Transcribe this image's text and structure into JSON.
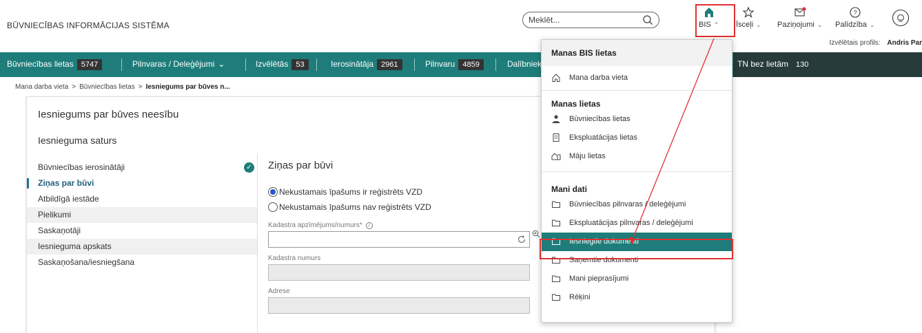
{
  "header": {
    "brand": "BŪVNIECĪBAS INFORMĀCIJAS SISTĒMA",
    "search_placeholder": "Meklēt...",
    "items": [
      {
        "label": "BIS",
        "icon": "home-icon"
      },
      {
        "label": "Īsceļi",
        "icon": "star-icon"
      },
      {
        "label": "Paziņojumi",
        "icon": "mail-icon"
      },
      {
        "label": "Palīdzība",
        "icon": "help-icon"
      }
    ],
    "profile_label": "Izvēlētais profils:",
    "profile_name": "Andris Par"
  },
  "nav": {
    "items": [
      {
        "label": "Būvniecības lietas",
        "count": "5747"
      },
      {
        "label": "Pilnvaras / Deleģējumi"
      },
      {
        "label": "Izvēlētās",
        "count": "53"
      },
      {
        "label": "Ierosinātāja",
        "count": "2961"
      },
      {
        "label": "Pilnvaru",
        "count": "4859"
      },
      {
        "label": "Dalībniek"
      },
      {
        "label": "TN bez lietām",
        "count": "130"
      }
    ]
  },
  "breadcrumb": {
    "items": [
      "Mana darba vieta",
      "Būvniecības lietas"
    ],
    "current": "Iesniegums par būves n..."
  },
  "page": {
    "title": "Iesniegums par būves neesību",
    "section": "Iesnieguma saturs"
  },
  "sidebar": {
    "items": [
      {
        "label": "Būvniecības ierosinātāji",
        "done": true
      },
      {
        "label": "Ziņas par būvi",
        "active": true
      },
      {
        "label": "Atbildīgā iestāde"
      },
      {
        "label": "Pielikumi"
      },
      {
        "label": "Saskaņotāji"
      },
      {
        "label": "Iesnieguma apskats"
      },
      {
        "label": "Saskaņošana/iesniegšana"
      }
    ]
  },
  "form": {
    "title": "Ziņas par būvi",
    "radio_registered": "Nekustamais īpašums ir reģistrēts VZD",
    "radio_not_registered": "Nekustamais īpašums nav reģistrēts VZD",
    "kadastrs_label": "Kadastra apzīmējums/numurs*",
    "kadastrs_value": "",
    "kadastra_numurs_label": "Kadastra numurs",
    "kadastra_numurs_value": "",
    "adrese_label": "Adrese",
    "adrese_value": ""
  },
  "dropdown": {
    "title": "Manas BIS lietas",
    "top_item": "Mana darba vieta",
    "section1": "Manas lietas",
    "lietas": [
      "Būvniecības lietas",
      "Ekspluatācijas lietas",
      "Māju lietas"
    ],
    "section2": "Mani dati",
    "dati": [
      "Būvniecības pilnvaras / deleģējumi",
      "Ekspluatācijas pilnvaras / deleģējumi",
      "Iesniegtie dokumenti",
      "Saņemtie dokumenti",
      "Mani pieprasījumi",
      "Rēķini"
    ],
    "highlighted": "Iesniegtie dokumenti"
  },
  "colors": {
    "teal": "#1e7d7a",
    "annotation_red": "#e03030"
  }
}
